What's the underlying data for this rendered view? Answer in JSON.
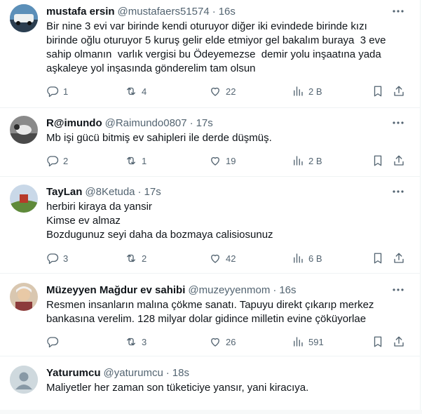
{
  "tweets": [
    {
      "name": "mustafa ersin",
      "handle": "@mustafaers51574",
      "time": "16s",
      "lines": [
        "Bir nine 3 evi var birinde kendi oturuyor diğer iki evindede birinde kızı",
        "birinde oğlu oturuyor 5 kuruş gelir elde etmiyor gel bakalım buraya  3 eve",
        "sahip olmanın  varlık vergisi bu Ödeyemezse  demir yolu inşaatına yada",
        "aşkaleye yol inşasında gönderelim tam olsun"
      ],
      "replies": "1",
      "retweets": "4",
      "likes": "22",
      "views": "2 B"
    },
    {
      "name": "R@imundo",
      "handle": "@Raimundo0807",
      "time": "17s",
      "lines": [
        "Mb işi gücü bitmiş ev sahipleri ile derde düşmüş."
      ],
      "replies": "2",
      "retweets": "1",
      "likes": "19",
      "views": "2 B"
    },
    {
      "name": "TayLan",
      "handle": "@8Ketuda",
      "time": "17s",
      "lines": [
        "herbiri kiraya da yansir",
        "Kimse ev almaz",
        "Bozdugunuz seyi daha da bozmaya calisiosunuz"
      ],
      "replies": "3",
      "retweets": "2",
      "likes": "42",
      "views": "6 B"
    },
    {
      "name": "Müzeyyen Mağdur ev sahibi",
      "handle": "@muzeyyenmom",
      "time": "16s",
      "lines": [
        "Resmen insanların malına çökme sanatı. Tapuyu direkt çıkarıp merkez",
        "bankasına verelim. 128 milyar dolar gidince milletin evine çöküyorlae"
      ],
      "replies": "",
      "retweets": "3",
      "likes": "26",
      "views": "591"
    },
    {
      "name": "Yaturumcu",
      "handle": "@yaturumcu",
      "time": "18s",
      "lines": [
        "Maliyetler her zaman son tüketiciye yansır, yani kiracıya."
      ],
      "replies": "",
      "retweets": "",
      "likes": "",
      "views": ""
    }
  ]
}
